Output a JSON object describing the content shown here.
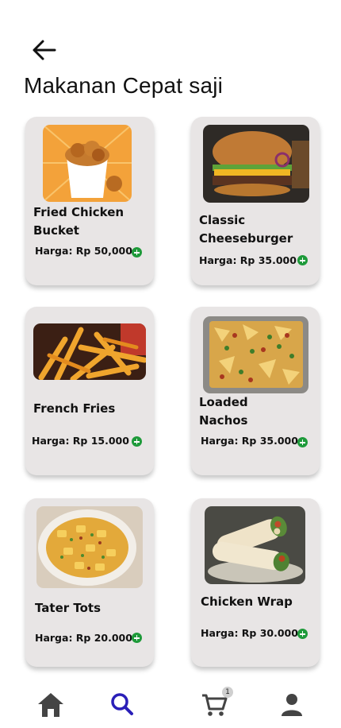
{
  "header": {
    "title": "Makanan Cepat saji"
  },
  "products": [
    {
      "name_line1": "Fried Chicken",
      "name_line2": "Bucket",
      "price": "Harga: Rp 50,000"
    },
    {
      "name_line1": "Classic",
      "name_line2": "Cheeseburger",
      "price": "Harga: Rp 35.000"
    },
    {
      "name_line1": "French Fries",
      "name_line2": "",
      "price": "Harga: Rp 15.000"
    },
    {
      "name_line1": "Loaded",
      "name_line2": "Nachos",
      "price": "Harga: Rp 35.000"
    },
    {
      "name_line1": "Tater Tots",
      "name_line2": "",
      "price": "Harga: Rp 20.000"
    },
    {
      "name_line1": "Chicken Wrap",
      "name_line2": "",
      "price": "Harga: Rp 30.000"
    }
  ],
  "nav": {
    "items": [
      {
        "icon": "home-icon",
        "active": false
      },
      {
        "icon": "search-icon",
        "active": true
      },
      {
        "icon": "cart-icon",
        "active": false
      },
      {
        "icon": "profile-icon",
        "active": false
      }
    ],
    "cart_badge": "1"
  },
  "colors": {
    "accent": "#2a1fb8",
    "add_button": "#1e9a3a",
    "card": "#e8e5e5",
    "nav_icon": "#444444"
  }
}
